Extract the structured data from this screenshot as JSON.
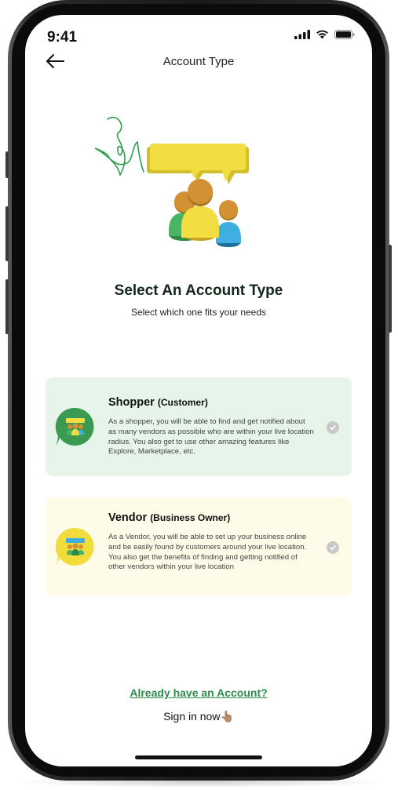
{
  "status_bar": {
    "time": "9:41",
    "icons": [
      "signal-bars-icon",
      "wifi-icon",
      "battery-icon"
    ]
  },
  "header": {
    "back_icon": "back-arrow-icon",
    "title": "Account Type"
  },
  "hero": {
    "icon": "people-chat-illustration"
  },
  "section": {
    "title": "Select An Account Type",
    "subtitle": "Select which one fits your needs"
  },
  "options": [
    {
      "title": "Shopper",
      "subtitle": "(Customer)",
      "description": "As a shopper, you will be able to find and get notified about as many vendors as possible who are within your live location radius. You also get to use other amazing features like Explore, Marketplace, etc.",
      "background": "#e6f4ea",
      "accent": "#3a9a52",
      "selected": false
    },
    {
      "title": "Vendor",
      "subtitle": "(Business Owner)",
      "description": "As a Vendor, you will be able to set up your business online and be easily found by customers around your live location. You also get the benefits of finding and getting notified of other vendors within your live location",
      "background": "#fefbe8",
      "accent": "#f2dc3c",
      "selected": false
    }
  ],
  "footer": {
    "already_link": "Already have an Account?",
    "signin_label": "Sign in now",
    "signin_emoji": "👆🏽"
  },
  "colors": {
    "brand_green": "#2e8b4a",
    "check_gray": "#c9c9c9"
  }
}
